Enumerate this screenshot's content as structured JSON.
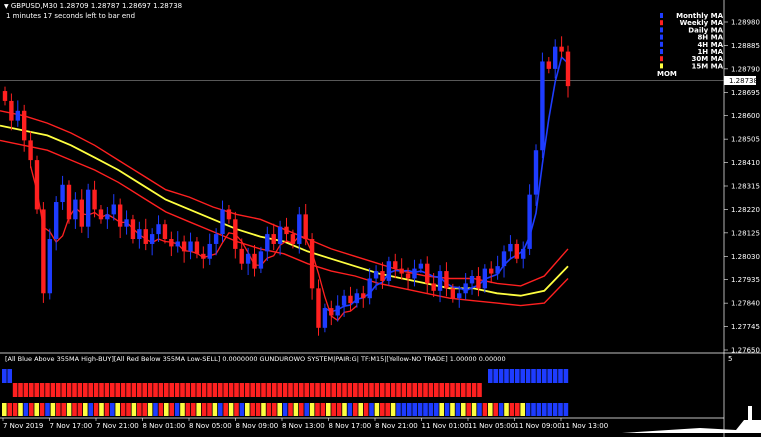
{
  "header": {
    "symbol_line": "GBPUSD,M30  1.28709 1.28787 1.28697 1.28738",
    "timer_line": "1 minutes 17 seconds left to bar end"
  },
  "current_price": "1.28738",
  "mom_label": "MOM",
  "price_axis": [
    "1.28980",
    "1.28885",
    "1.28790",
    "1.28695",
    "1.28600",
    "1.28505",
    "1.28410",
    "1.28315",
    "1.28220",
    "1.28125",
    "1.28030",
    "1.27935",
    "1.27840",
    "1.27745",
    "1.27650"
  ],
  "time_axis": [
    "7 Nov 2019",
    "7 Nov 17:00",
    "7 Nov 21:00",
    "8 Nov 01:00",
    "8 Nov 05:00",
    "8 Nov 09:00",
    "8 Nov 13:00",
    "8 Nov 17:00",
    "8 Nov 21:00",
    "11 Nov 01:00",
    "11 Nov 05:00",
    "11 Nov 09:00",
    "11 Nov 13:00"
  ],
  "ma_panel": [
    {
      "label": "Monthly MA",
      "color": "#1e3cff"
    },
    {
      "label": "Weekly MA",
      "color": "#ff2020"
    },
    {
      "label": "Daily MA",
      "color": "#1e3cff"
    },
    {
      "label": "8H MA",
      "color": "#1e3cff"
    },
    {
      "label": "4H MA",
      "color": "#1e3cff"
    },
    {
      "label": "1H MA",
      "color": "#1e3cff"
    },
    {
      "label": "30M MA",
      "color": "#ff2020"
    },
    {
      "label": "15M MA",
      "color": "#ffff40"
    }
  ],
  "indicator_text": "[All Blue Above 355MA High-BUY][All Red Below 355MA Low-SELL] 0.0000000  GUNDUROWO SYSTEM|PAIR:G| TF:M15|[Yellow-NO TRADE] 1.00000 0.00000",
  "indicator_axis_label": "5",
  "colors": {
    "bull": "#1e3cff",
    "bear": "#ff2020",
    "neutral": "#ffff40",
    "ma_yellow": "#ffff40",
    "ma_red": "#ff2020",
    "ma_blue": "#1e3cff"
  },
  "chart_data": {
    "type": "candlestick",
    "ylim": [
      1.2765,
      1.2905
    ],
    "closes": [
      1.2866,
      1.2858,
      1.2862,
      1.285,
      1.2842,
      1.2822,
      1.2788,
      1.281,
      1.2825,
      1.2832,
      1.2818,
      1.2826,
      1.2815,
      1.283,
      1.2822,
      1.2818,
      1.282,
      1.2824,
      1.2815,
      1.2818,
      1.281,
      1.2814,
      1.2808,
      1.2812,
      1.2816,
      1.281,
      1.2807,
      1.2809,
      1.2805,
      1.2809,
      1.2804,
      1.2802,
      1.2808,
      1.2812,
      1.2822,
      1.2818,
      1.2806,
      1.28,
      1.2804,
      1.2798,
      1.2805,
      1.2812,
      1.2808,
      1.2815,
      1.2812,
      1.2808,
      1.282,
      1.281,
      1.279,
      1.2774,
      1.2782,
      1.2779,
      1.2783,
      1.2787,
      1.2784,
      1.2788,
      1.2786,
      1.2794,
      1.2797,
      1.2793,
      1.2801,
      1.2798,
      1.2796,
      1.2794,
      1.2798,
      1.28,
      1.2792,
      1.2789,
      1.2797,
      1.279,
      1.2786,
      1.2788,
      1.2792,
      1.2795,
      1.279,
      1.2798,
      1.2796,
      1.2799,
      1.2805,
      1.2808,
      1.2802,
      1.2806,
      1.2828,
      1.2846,
      1.2882,
      1.2879,
      1.2888,
      1.2886,
      1.2872
    ],
    "ma_yellow": [
      1.2856,
      1.2854,
      1.2852,
      1.2848,
      1.2843,
      1.2838,
      1.2832,
      1.2826,
      1.2822,
      1.2818,
      1.2814,
      1.2811,
      1.2809,
      1.2805,
      1.2802,
      1.2799,
      1.2796,
      1.2794,
      1.2792,
      1.279,
      1.279,
      1.2788,
      1.2787,
      1.2789,
      1.2799
    ],
    "ma_red_upper": [
      1.2862,
      1.286,
      1.2857,
      1.2853,
      1.2848,
      1.2842,
      1.2836,
      1.283,
      1.2827,
      1.2823,
      1.282,
      1.2818,
      1.2814,
      1.281,
      1.2806,
      1.2803,
      1.28,
      1.2797,
      1.2795,
      1.2794,
      1.2794,
      1.2792,
      1.2791,
      1.2795,
      1.2806
    ],
    "ma_red_lower": [
      1.285,
      1.2848,
      1.2846,
      1.2842,
      1.2838,
      1.2833,
      1.2827,
      1.2821,
      1.2817,
      1.2813,
      1.2809,
      1.2806,
      1.2804,
      1.28,
      1.2797,
      1.2795,
      1.2792,
      1.279,
      1.2788,
      1.2786,
      1.2785,
      1.2784,
      1.2783,
      1.2784,
      1.2794
    ]
  }
}
